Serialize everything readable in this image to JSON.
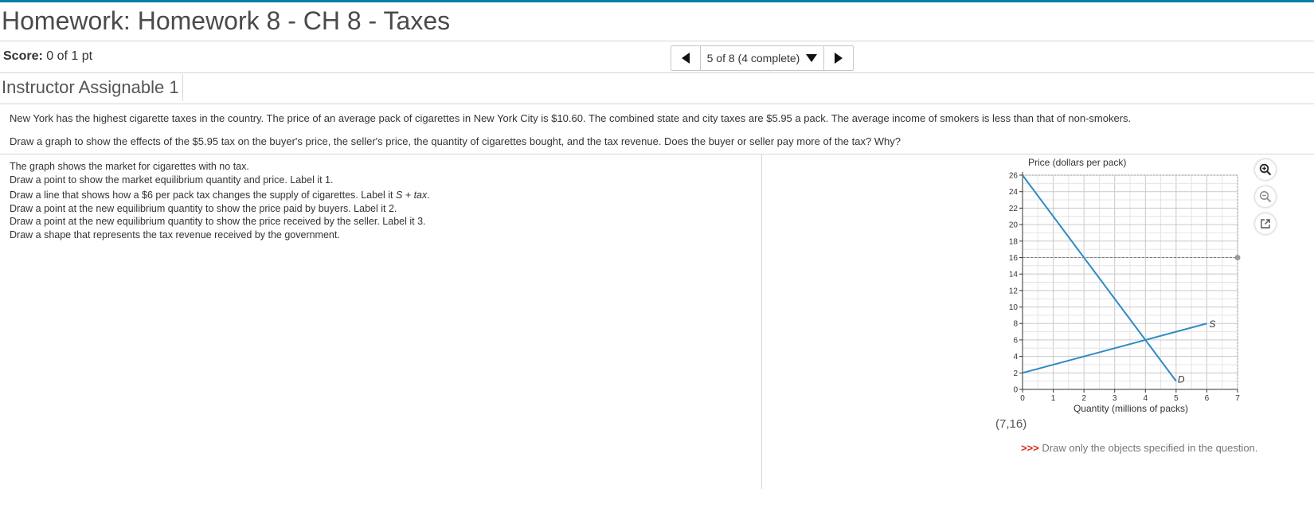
{
  "header": {
    "title": "Homework: Homework 8 - CH 8 - Taxes",
    "score_label": "Score:",
    "score_value": "0 of 1 pt"
  },
  "nav": {
    "progress": "5 of 8 (4 complete)"
  },
  "assignment": {
    "tab_label": "Instructor Assignable 1"
  },
  "question": {
    "paragraph1": "New York has the highest cigarette taxes in the country. The price of an average pack of cigarettes in New York City is $10.60. The combined state and city taxes are $5.95 a pack. The average income of smokers is less than that of non-smokers.",
    "paragraph2": "Draw a graph to show the effects of the $5.95 tax on the buyer's price, the seller's price, the quantity of cigarettes bought, and the tax revenue. Does the buyer or seller pay more of the tax? Why?"
  },
  "instructions": {
    "line1": "The graph shows the market for cigarettes with no tax.",
    "line2": "Draw a point to show the market equilibrium quantity and price. Label it 1.",
    "line3_pre": "Draw a line that shows how a $6 per pack tax changes the supply of cigarettes. Label it ",
    "line3_italic": "S + tax",
    "line3_post": ".",
    "line4": "Draw a point at the new equilibrium quantity to show the price paid by buyers. Label it 2.",
    "line5": "Draw a point at the new equilibrium quantity to show the price received by the seller. Label it 3.",
    "line6": "Draw a shape that represents the tax revenue received by the government."
  },
  "chart_data": {
    "type": "line",
    "ylabel": "Price (dollars per pack)",
    "xlabel": "Quantity (millions of packs)",
    "xlim": [
      0,
      7
    ],
    "ylim": [
      0,
      26
    ],
    "x_ticks": [
      0,
      1,
      2,
      3,
      4,
      5,
      6,
      7
    ],
    "y_ticks": [
      0,
      2,
      4,
      6,
      8,
      10,
      12,
      14,
      16,
      18,
      20,
      22,
      24,
      26
    ],
    "grid": true,
    "series": [
      {
        "name": "D",
        "points": [
          [
            0,
            26
          ],
          [
            5,
            1
          ]
        ],
        "color": "#2f8ac4"
      },
      {
        "name": "S",
        "points": [
          [
            0,
            2
          ],
          [
            6,
            8
          ]
        ],
        "color": "#2f8ac4"
      }
    ],
    "guide_line_y": 16,
    "cursor_point": [
      7,
      16
    ]
  },
  "tools": {
    "zoom_in_icon": "zoom-in-icon",
    "zoom_out_icon": "zoom-out-icon",
    "popout_icon": "popout-icon"
  },
  "coordinate_readout": "(7,16)",
  "hint": {
    "arrows": ">>>",
    "text": "Draw only the objects specified in the question."
  }
}
